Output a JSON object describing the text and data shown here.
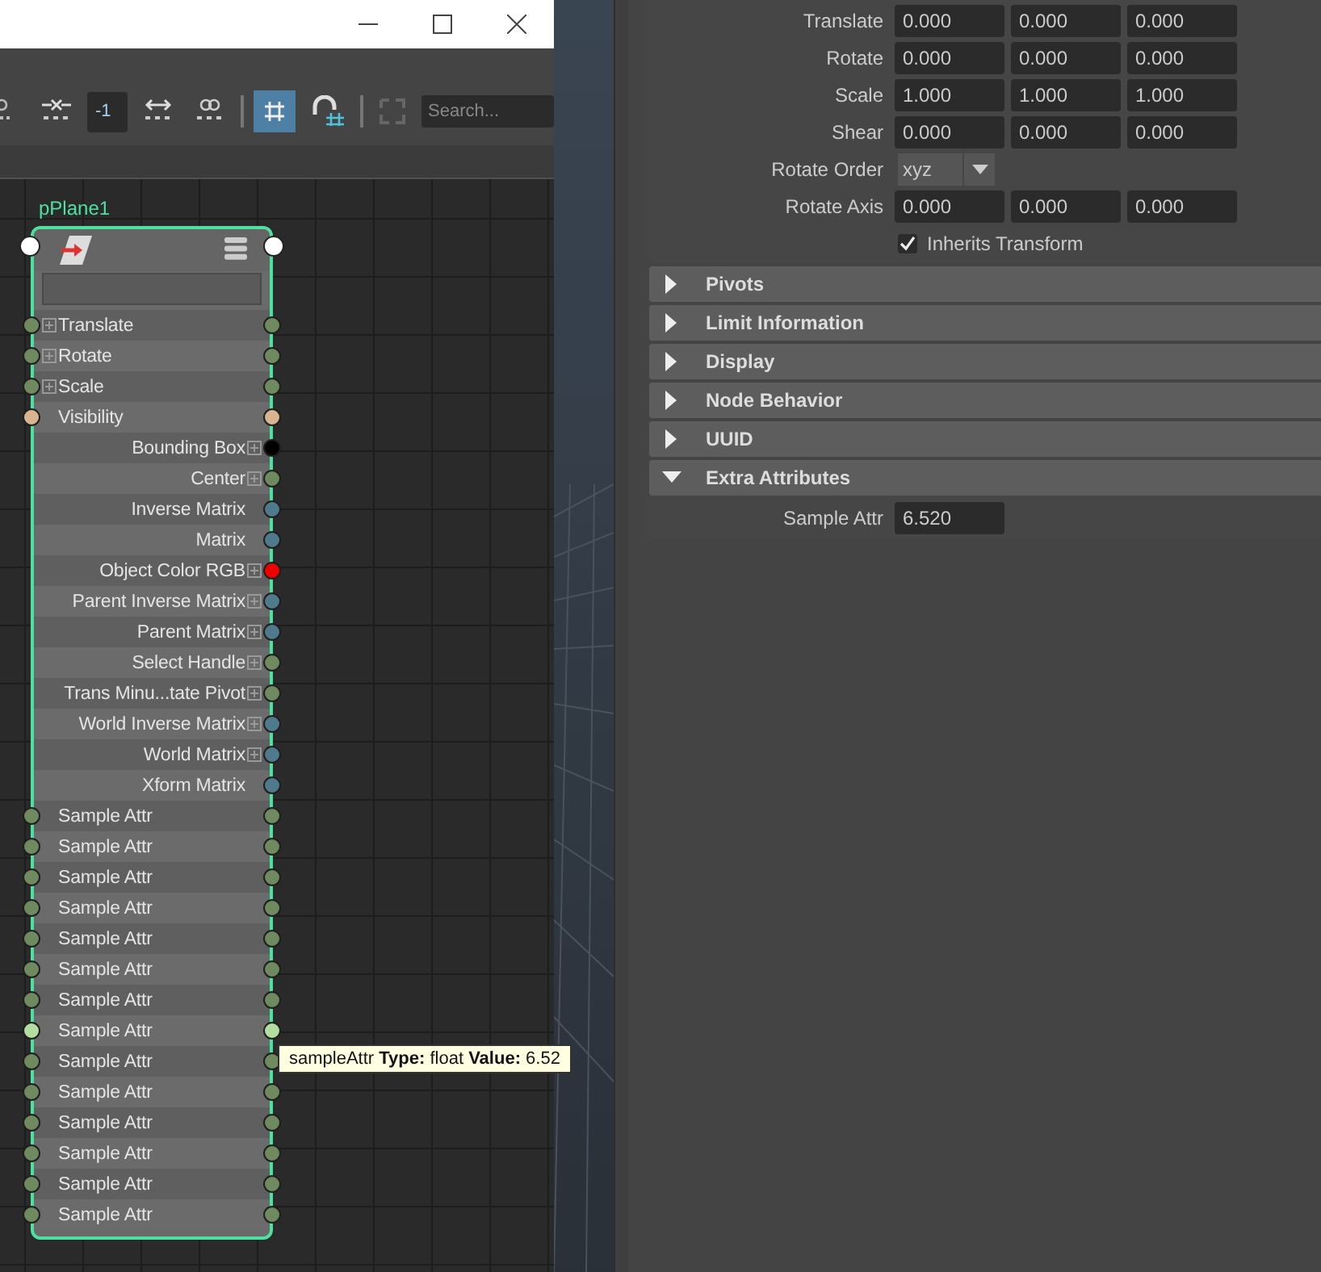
{
  "toolbar": {
    "frame_field": "-1",
    "grid_snap_on": true,
    "search": {
      "placeholder": "Search..."
    }
  },
  "node": {
    "name": "pPlane1",
    "rows": [
      {
        "label": "Translate",
        "kind": "input",
        "expandable": true,
        "color": "#6f8a5e"
      },
      {
        "label": "Rotate",
        "kind": "input",
        "expandable": true,
        "color": "#6f8a5e"
      },
      {
        "label": "Scale",
        "kind": "input",
        "expandable": true,
        "color": "#6f8a5e"
      },
      {
        "label": "Visibility",
        "kind": "input",
        "expandable": false,
        "color": "#d9b48f"
      },
      {
        "label": "Bounding Box",
        "kind": "output",
        "expandable": true,
        "color": "#000000"
      },
      {
        "label": "Center",
        "kind": "output",
        "expandable": true,
        "color": "#6f8a5e"
      },
      {
        "label": "Inverse Matrix",
        "kind": "output",
        "expandable": false,
        "color": "#4f7a8c"
      },
      {
        "label": "Matrix",
        "kind": "output",
        "expandable": false,
        "color": "#4f7a8c"
      },
      {
        "label": "Object Color RGB",
        "kind": "output",
        "expandable": true,
        "color": "#ee0000"
      },
      {
        "label": "Parent Inverse Matrix",
        "kind": "output",
        "expandable": true,
        "color": "#4f7a8c"
      },
      {
        "label": "Parent Matrix",
        "kind": "output",
        "expandable": true,
        "color": "#4f7a8c"
      },
      {
        "label": "Select Handle",
        "kind": "output",
        "expandable": true,
        "color": "#6f8a5e"
      },
      {
        "label": "Trans Minu...tate Pivot",
        "kind": "output",
        "expandable": true,
        "color": "#6f8a5e"
      },
      {
        "label": "World Inverse Matrix",
        "kind": "output",
        "expandable": true,
        "color": "#4f7a8c"
      },
      {
        "label": "World Matrix",
        "kind": "output",
        "expandable": true,
        "color": "#4f7a8c"
      },
      {
        "label": "Xform Matrix",
        "kind": "output",
        "expandable": false,
        "color": "#4f7a8c"
      },
      {
        "label": "Sample Attr",
        "kind": "input",
        "expandable": false,
        "color": "#6f8a5e"
      },
      {
        "label": "Sample Attr",
        "kind": "input",
        "expandable": false,
        "color": "#6f8a5e"
      },
      {
        "label": "Sample Attr",
        "kind": "input",
        "expandable": false,
        "color": "#6f8a5e"
      },
      {
        "label": "Sample Attr",
        "kind": "input",
        "expandable": false,
        "color": "#6f8a5e"
      },
      {
        "label": "Sample Attr",
        "kind": "input",
        "expandable": false,
        "color": "#6f8a5e"
      },
      {
        "label": "Sample Attr",
        "kind": "input",
        "expandable": false,
        "color": "#6f8a5e"
      },
      {
        "label": "Sample Attr",
        "kind": "input",
        "expandable": false,
        "color": "#6f8a5e"
      },
      {
        "label": "Sample Attr",
        "kind": "input",
        "expandable": false,
        "color": "#b4dea0"
      },
      {
        "label": "Sample Attr",
        "kind": "input",
        "expandable": false,
        "color": "#6f8a5e"
      },
      {
        "label": "Sample Attr",
        "kind": "input",
        "expandable": false,
        "color": "#6f8a5e"
      },
      {
        "label": "Sample Attr",
        "kind": "input",
        "expandable": false,
        "color": "#6f8a5e"
      },
      {
        "label": "Sample Attr",
        "kind": "input",
        "expandable": false,
        "color": "#6f8a5e"
      },
      {
        "label": "Sample Attr",
        "kind": "input",
        "expandable": false,
        "color": "#6f8a5e"
      },
      {
        "label": "Sample Attr",
        "kind": "input",
        "expandable": false,
        "color": "#6f8a5e"
      }
    ]
  },
  "tooltip": "sampleAttr **Type:** float **Value:** 6.52",
  "transform_attributes": [
    {
      "label": "Translate",
      "kind": "vector",
      "values": [
        "0.000",
        "0.000",
        "0.000"
      ]
    },
    {
      "label": "Rotate",
      "kind": "vector",
      "values": [
        "0.000",
        "0.000",
        "0.000"
      ]
    },
    {
      "label": "Scale",
      "kind": "vector",
      "values": [
        "1.000",
        "1.000",
        "1.000"
      ]
    },
    {
      "label": "Shear",
      "kind": "vector",
      "values": [
        "0.000",
        "0.000",
        "0.000"
      ]
    },
    {
      "label": "Rotate Order",
      "kind": "dropdown",
      "value": "xyz"
    },
    {
      "label": "Rotate Axis",
      "kind": "vector",
      "values": [
        "0.000",
        "0.000",
        "0.000"
      ]
    }
  ],
  "inherits_transform": {
    "label": "Inherits Transform",
    "checked": true
  },
  "sections": [
    {
      "title": "Pivots",
      "expanded": false
    },
    {
      "title": "Limit Information",
      "expanded": false
    },
    {
      "title": "Display",
      "expanded": false
    },
    {
      "title": "Node Behavior",
      "expanded": false
    },
    {
      "title": "UUID",
      "expanded": false
    },
    {
      "title": "Extra Attributes",
      "expanded": true,
      "attributes": [
        {
          "label": "Sample Attr",
          "value": "6.520"
        }
      ]
    }
  ]
}
